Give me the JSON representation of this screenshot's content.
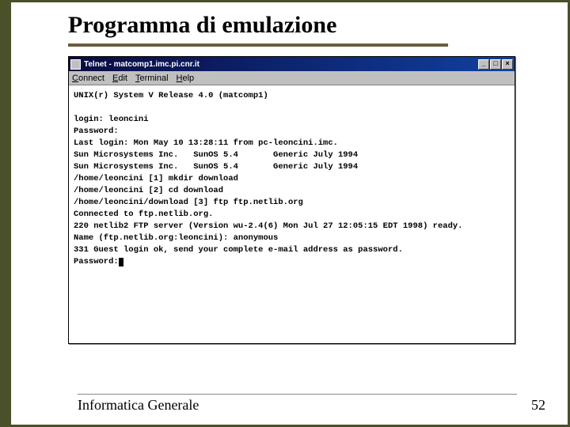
{
  "slide": {
    "title": "Programma di emulazione",
    "footer_left": "Informatica Generale",
    "footer_right": "52"
  },
  "window": {
    "title": "Telnet - matcomp1.imc.pi.cnr.it",
    "buttons": {
      "min": "_",
      "max": "□",
      "close": "×"
    },
    "menu": {
      "connect": "Connect",
      "edit": "Edit",
      "terminal": "Terminal",
      "help": "Help"
    }
  },
  "terminal": {
    "lines": [
      "UNIX(r) System V Release 4.0 (matcomp1)",
      "",
      "login: leoncini",
      "Password:",
      "Last login: Mon May 10 13:28:11 from pc-leoncini.imc.",
      "Sun Microsystems Inc.   SunOS 5.4       Generic July 1994",
      "Sun Microsystems Inc.   SunOS 5.4       Generic July 1994",
      "/home/leoncini [1] mkdir download",
      "/home/leoncini [2] cd download",
      "/home/leoncini/download [3] ftp ftp.netlib.org",
      "Connected to ftp.netlib.org.",
      "220 netlib2 FTP server (Version wu-2.4(6) Mon Jul 27 12:05:15 EDT 1998) ready.",
      "Name (ftp.netlib.org:leoncini): anonymous",
      "331 Guest login ok, send your complete e-mail address as password.",
      "Password:"
    ]
  }
}
